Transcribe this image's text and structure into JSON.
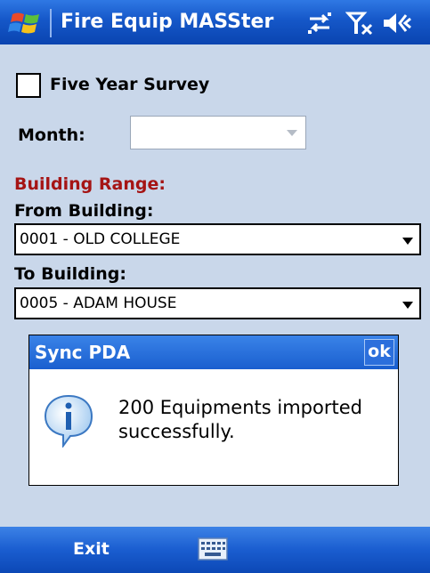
{
  "titlebar": {
    "app_title": "Fire Equip MASSter",
    "icons": [
      "windows-start-icon",
      "connectivity-icon",
      "signal-off-icon",
      "volume-icon"
    ]
  },
  "form": {
    "five_year_survey_label": "Five Year Survey",
    "five_year_survey_checked": false,
    "month_label": "Month:",
    "month_value": "",
    "building_range_label": "Building Range:",
    "from_building_label": "From Building:",
    "from_building_value": "0001 - OLD COLLEGE",
    "to_building_label": "To Building:",
    "to_building_value": "0005 - ADAM HOUSE"
  },
  "dialog": {
    "title": "Sync PDA",
    "ok_label": "ok",
    "icon": "info-icon",
    "message": "200 Equipments imported successfully."
  },
  "menubar": {
    "left_label": "Exit",
    "center_icon": "keyboard-icon"
  },
  "colors": {
    "background": "#c9d7ea",
    "titlebar": "#1557c8",
    "accent_red": "#a51414"
  }
}
